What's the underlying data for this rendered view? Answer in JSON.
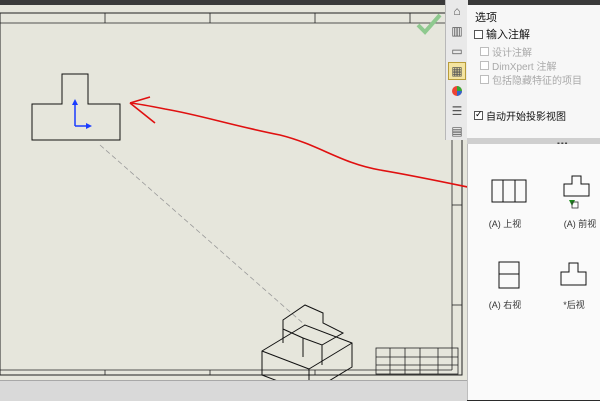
{
  "options_panel": {
    "title": "选项",
    "input_annotation": "输入注解",
    "design_annotation": "设计注解",
    "dimxpert_annotation": "DimXpert 注解",
    "include_hidden": "包括隐藏特征的项目",
    "auto_projection": "自动开始投影视图",
    "input_annotation_checked": false,
    "auto_projection_checked": true
  },
  "view_palette": {
    "views": [
      {
        "label": "(A) 上视",
        "icon": "top-view-icon"
      },
      {
        "label": "(A) 前视",
        "icon": "front-view-icon"
      },
      {
        "label": "(A) 右视",
        "icon": "right-view-icon"
      },
      {
        "label": "*后视",
        "icon": "back-view-icon"
      }
    ]
  },
  "side_tabs": [
    {
      "icon": "home-icon"
    },
    {
      "icon": "model-icon"
    },
    {
      "icon": "folder-icon"
    },
    {
      "icon": "view-palette-icon",
      "active": true
    },
    {
      "icon": "appearance-icon"
    },
    {
      "icon": "properties-icon"
    },
    {
      "icon": "forum-icon"
    }
  ],
  "colors": {
    "sheet_bg": "#e6e6dc",
    "annotation_arrow": "#e01010",
    "axis_blue": "#1a3cff"
  }
}
